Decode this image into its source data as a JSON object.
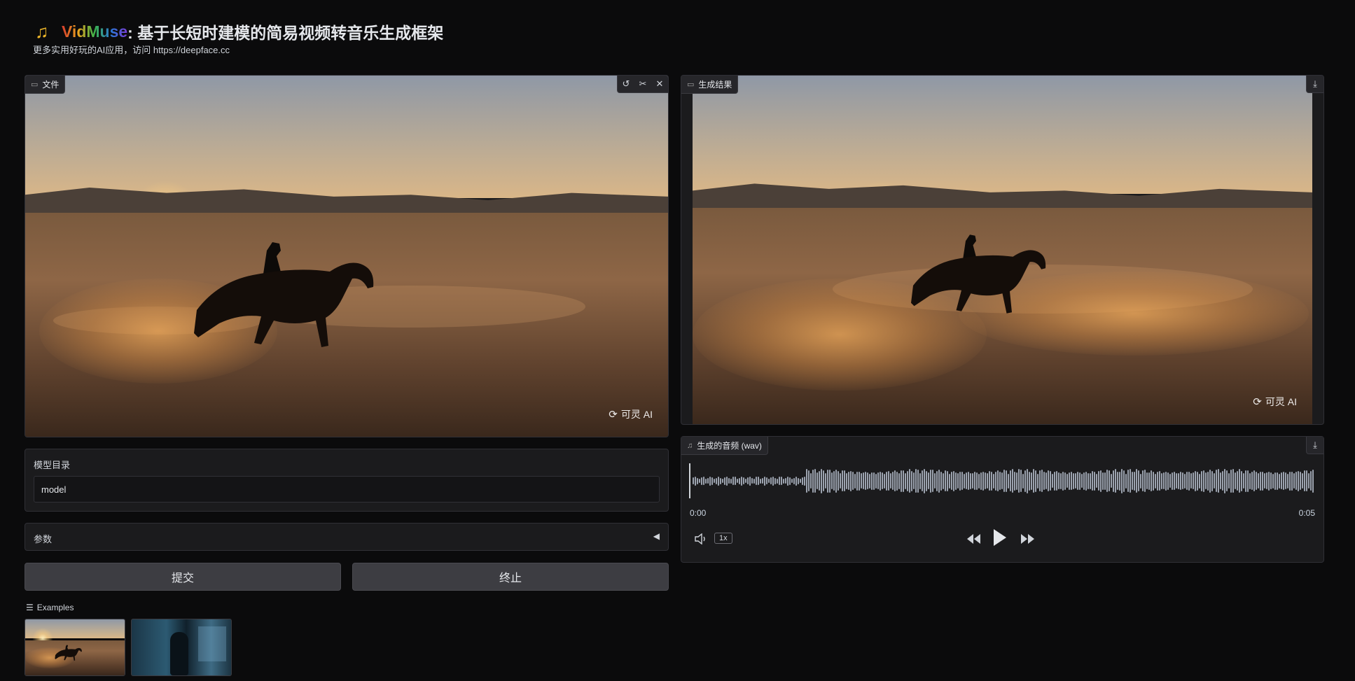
{
  "header": {
    "brand": "VidMuse",
    "title_rest": ": 基于长短时建模的简易视频转音乐生成框架",
    "subtitle": "更多实用好玩的AI应用，访问 https://deepface.cc"
  },
  "input_video": {
    "label": "文件",
    "watermark": "可灵 AI",
    "tools": [
      "undo-icon",
      "scissors-icon",
      "close-icon"
    ]
  },
  "output_video": {
    "label": "生成结果",
    "watermark": "可灵 AI"
  },
  "model_dir": {
    "label": "模型目录",
    "value": "model"
  },
  "params": {
    "label": "参数"
  },
  "buttons": {
    "submit": "提交",
    "stop": "终止"
  },
  "examples": {
    "label": "Examples",
    "items": [
      "desert-rider-thumbnail",
      "city-figure-thumbnail"
    ]
  },
  "audio": {
    "label": "生成的音频 (wav)",
    "time_start": "0:00",
    "time_end": "0:05",
    "speed": "1x"
  },
  "colors": {
    "background": "#0b0b0c",
    "panel": "#1b1b1d",
    "button": "#3d3d42"
  }
}
